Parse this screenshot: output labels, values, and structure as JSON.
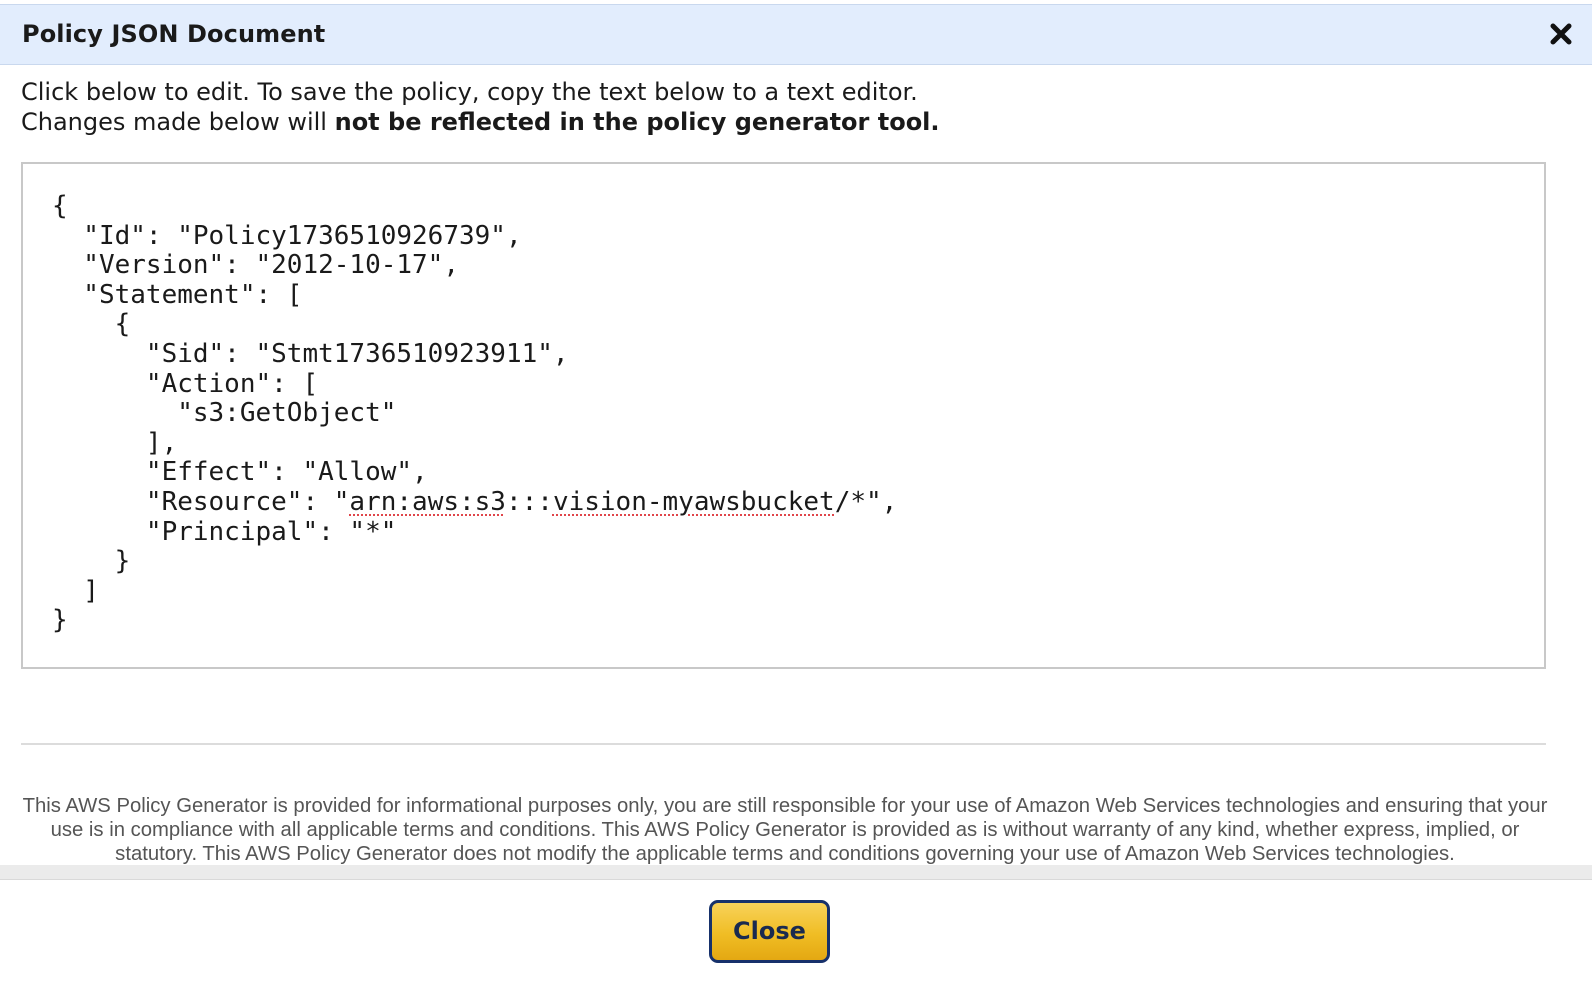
{
  "dialog": {
    "title": "Policy JSON Document",
    "close_icon": "close-icon"
  },
  "instructions": {
    "line1": "Click below to edit. To save the policy, copy the text below to a text editor.",
    "line2_prefix": "Changes made below will ",
    "line2_bold": "not be reflected in the policy generator tool."
  },
  "policy_editor": {
    "lines": {
      "l1": "{",
      "l2": "  \"Id\": \"Policy1736510926739\",",
      "l3": "  \"Version\": \"2012-10-17\",",
      "l4": "  \"Statement\": [",
      "l5": "    {",
      "l6": "      \"Sid\": \"Stmt1736510923911\",",
      "l7": "      \"Action\": [",
      "l8": "        \"s3:GetObject\"",
      "l9": "      ],",
      "l10": "      \"Effect\": \"Allow\",",
      "l11_a": "      \"Resource\": \"",
      "l11_b": "arn:aws:s3",
      "l11_c": ":::",
      "l11_d": "vision-myawsbucket",
      "l11_e": "/*\",",
      "l12": "      \"Principal\": \"*\"",
      "l13": "    }",
      "l14": "  ]",
      "l15": "}"
    }
  },
  "disclaimer": "This AWS Policy Generator is provided for informational purposes only, you are still responsible for your use of Amazon Web Services technologies and ensuring that your use is in compliance with all applicable terms and conditions. This AWS Policy Generator is provided as is without warranty of any kind, whether express, implied, or statutory. This AWS Policy Generator does not modify the applicable terms and conditions governing your use of Amazon Web Services technologies.",
  "footer": {
    "close_label": "Close"
  },
  "colors": {
    "title_bar": "#e2edfd",
    "button_gold": "#f0bd24",
    "button_border": "#17316b",
    "spellcheck": "#e0454a"
  }
}
